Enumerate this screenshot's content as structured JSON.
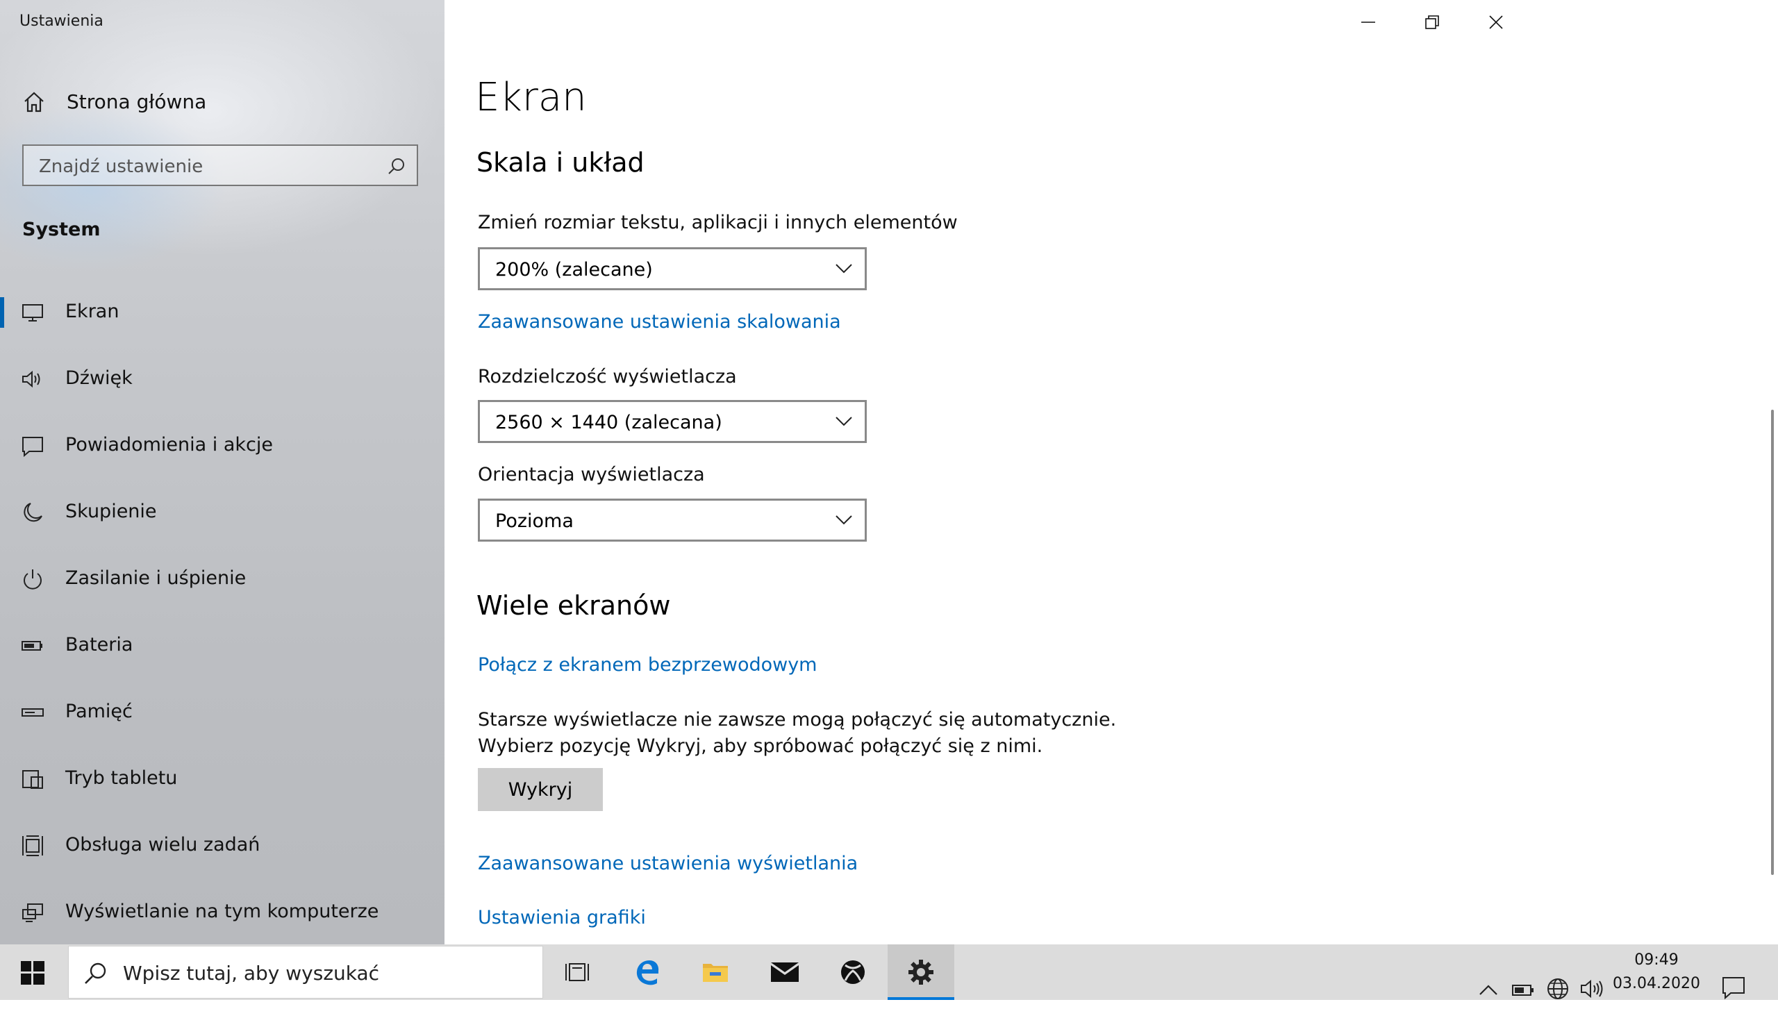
{
  "window": {
    "title": "Ustawienia"
  },
  "sidebar": {
    "home_label": "Strona główna",
    "search_placeholder": "Znajdź ustawienie",
    "section": "System",
    "items": [
      {
        "label": "Ekran",
        "icon": "monitor-icon",
        "selected": true
      },
      {
        "label": "Dźwięk",
        "icon": "speaker-icon"
      },
      {
        "label": "Powiadomienia i akcje",
        "icon": "notification-icon"
      },
      {
        "label": "Skupienie",
        "icon": "moon-icon"
      },
      {
        "label": "Zasilanie i uśpienie",
        "icon": "power-icon"
      },
      {
        "label": "Bateria",
        "icon": "battery-icon"
      },
      {
        "label": "Pamięć",
        "icon": "storage-icon"
      },
      {
        "label": "Tryb tabletu",
        "icon": "tablet-icon"
      },
      {
        "label": "Obsługa wielu zadań",
        "icon": "multitasking-icon"
      },
      {
        "label": "Wyświetlanie na tym komputerze",
        "icon": "project-icon"
      }
    ]
  },
  "main": {
    "title": "Ekran",
    "scale_section": {
      "heading": "Skala i układ",
      "text_size_label": "Zmień rozmiar tekstu, aplikacji i innych elementów",
      "text_size_value": "200% (zalecane)",
      "advanced_scaling_link": "Zaawansowane ustawienia skalowania",
      "resolution_label": "Rozdzielczość wyświetlacza",
      "resolution_value": "2560 × 1440 (zalecana)",
      "orientation_label": "Orientacja wyświetlacza",
      "orientation_value": "Pozioma"
    },
    "multi_section": {
      "heading": "Wiele ekranów",
      "wireless_link": "Połącz z ekranem bezprzewodowym",
      "info_line1": "Starsze wyświetlacze nie zawsze mogą połączyć się automatycznie.",
      "info_line2": "Wybierz pozycję Wykryj, aby spróbować połączyć się z nimi.",
      "detect_button": "Wykryj",
      "advanced_display_link": "Zaawansowane ustawienia wyświetlania",
      "graphics_link": "Ustawienia grafiki"
    }
  },
  "taskbar": {
    "search_placeholder": "Wpisz tutaj, aby wyszukać",
    "apps": [
      "task-view-icon",
      "edge-icon",
      "file-explorer-icon",
      "mail-icon",
      "xbox-icon",
      "settings-icon"
    ],
    "time": "09:49",
    "date": "03.04.2020"
  },
  "colors": {
    "accent": "#0063b1",
    "link": "#0067b8"
  }
}
